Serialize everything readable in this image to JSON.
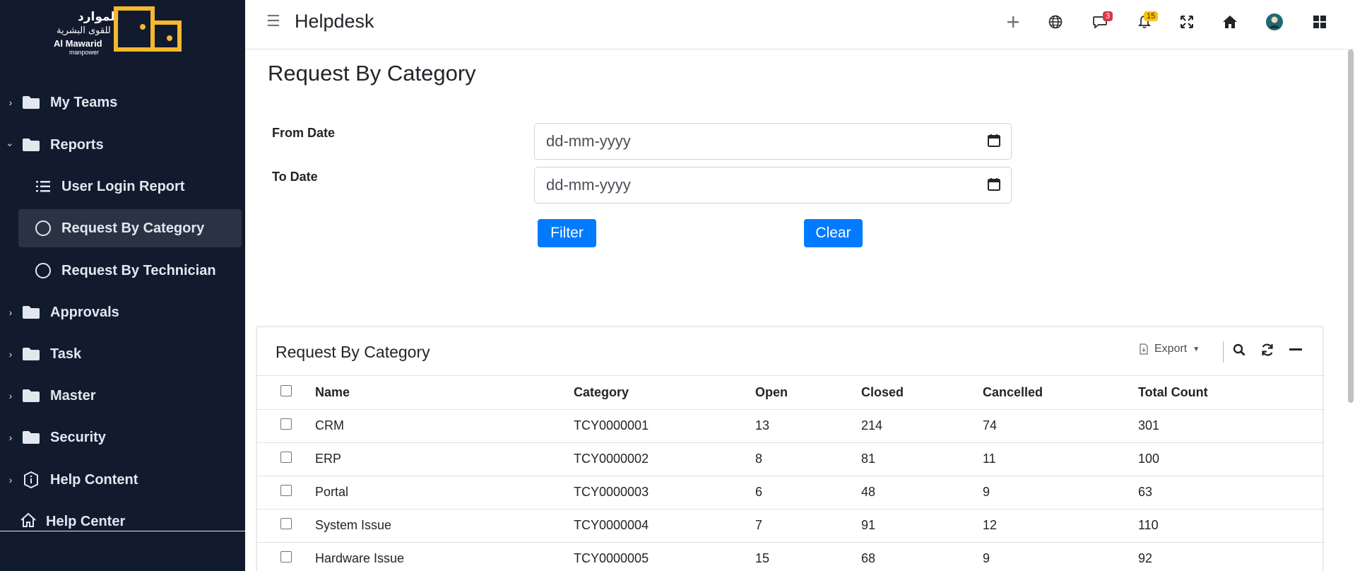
{
  "logo": {
    "arabic_line1": "الموارد",
    "arabic_line2": "للقوى البشرية",
    "english_line1": "Al Mawarid",
    "english_line2": "manpower",
    "accent_color": "#f5b82e"
  },
  "sidebar": {
    "items": [
      {
        "label": "My Teams",
        "icon": "folder-icon",
        "expanded": false
      },
      {
        "label": "Reports",
        "icon": "folder-icon",
        "expanded": true
      },
      {
        "label": "User Login Report",
        "icon": "list-icon"
      },
      {
        "label": "Request By Category",
        "icon": "circle-icon",
        "active": true
      },
      {
        "label": "Request By Technician",
        "icon": "circle-icon"
      },
      {
        "label": "Approvals",
        "icon": "folder-icon",
        "expanded": false
      },
      {
        "label": "Task",
        "icon": "folder-icon",
        "expanded": false
      },
      {
        "label": "Master",
        "icon": "folder-icon",
        "expanded": false
      },
      {
        "label": "Security",
        "icon": "folder-icon",
        "expanded": false
      },
      {
        "label": "Help Content",
        "icon": "info-icon",
        "expanded": false
      },
      {
        "label": "Help Center",
        "icon": "home-outline-icon"
      }
    ]
  },
  "topbar": {
    "title": "Helpdesk",
    "messages_badge": "3",
    "notifications_badge": "15",
    "icons": [
      "plus-icon",
      "globe-icon",
      "chat-icon",
      "bell-icon",
      "expand-icon",
      "home-icon",
      "avatar",
      "grid-icon"
    ]
  },
  "page": {
    "title": "Request By Category",
    "from_label": "From Date",
    "to_label": "To Date",
    "from_placeholder": "dd-mm-yyyy",
    "to_placeholder": "dd-mm-yyyy",
    "filter_label": "Filter",
    "clear_label": "Clear"
  },
  "card": {
    "title": "Request By Category",
    "export_label": "Export",
    "columns": [
      "Name",
      "Category",
      "Open",
      "Closed",
      "Cancelled",
      "Total Count"
    ],
    "rows": [
      [
        "CRM",
        "TCY0000001",
        "13",
        "214",
        "74",
        "301"
      ],
      [
        "ERP",
        "TCY0000002",
        "8",
        "81",
        "11",
        "100"
      ],
      [
        "Portal",
        "TCY0000003",
        "6",
        "48",
        "9",
        "63"
      ],
      [
        "System Issue",
        "TCY0000004",
        "7",
        "91",
        "12",
        "110"
      ],
      [
        "Hardware Issue",
        "TCY0000005",
        "15",
        "68",
        "9",
        "92"
      ]
    ]
  },
  "colors": {
    "sidebar_bg": "#121a2e",
    "primary": "#007bff",
    "badge_red": "#dc3545",
    "badge_yellow": "#ffc107"
  }
}
